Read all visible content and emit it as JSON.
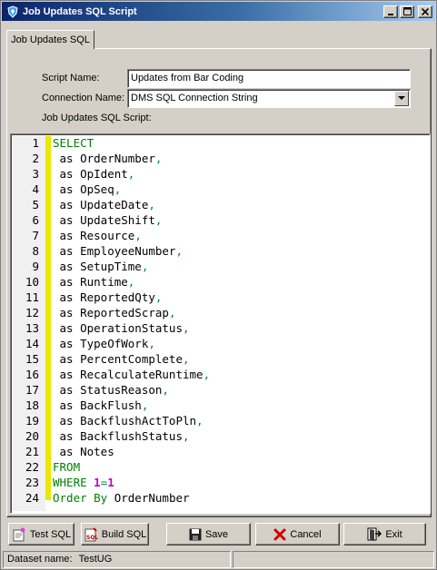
{
  "window": {
    "title": "Job Updates SQL Script"
  },
  "titlebar_buttons": {
    "minimize": "_",
    "maximize": "□",
    "close": "×"
  },
  "tab": {
    "label": "Job Updates SQL"
  },
  "form": {
    "script_name_label": "Script Name:",
    "script_name_value": "Updates from Bar Coding",
    "connection_name_label": "Connection Name:",
    "connection_name_value": "DMS SQL Connection String",
    "script_label": "Job Updates SQL Script:"
  },
  "editor": {
    "lines": [
      {
        "n": "1",
        "tokens": [
          [
            "kw",
            "SELECT"
          ]
        ]
      },
      {
        "n": "2",
        "tokens": [
          [
            "txt",
            " as OrderNumber"
          ],
          [
            "punc",
            ","
          ]
        ]
      },
      {
        "n": "3",
        "tokens": [
          [
            "txt",
            " as OpIdent"
          ],
          [
            "punc",
            ","
          ]
        ]
      },
      {
        "n": "4",
        "tokens": [
          [
            "txt",
            " as OpSeq"
          ],
          [
            "punc",
            ","
          ]
        ]
      },
      {
        "n": "5",
        "tokens": [
          [
            "txt",
            " as UpdateDate"
          ],
          [
            "punc",
            ","
          ]
        ]
      },
      {
        "n": "6",
        "tokens": [
          [
            "txt",
            " as UpdateShift"
          ],
          [
            "punc",
            ","
          ]
        ]
      },
      {
        "n": "7",
        "tokens": [
          [
            "txt",
            " as Resource"
          ],
          [
            "punc",
            ","
          ]
        ]
      },
      {
        "n": "8",
        "tokens": [
          [
            "txt",
            " as EmployeeNumber"
          ],
          [
            "punc",
            ","
          ]
        ]
      },
      {
        "n": "9",
        "tokens": [
          [
            "txt",
            " as SetupTime"
          ],
          [
            "punc",
            ","
          ]
        ]
      },
      {
        "n": "10",
        "tokens": [
          [
            "txt",
            " as Runtime"
          ],
          [
            "punc",
            ","
          ]
        ]
      },
      {
        "n": "11",
        "tokens": [
          [
            "txt",
            " as ReportedQty"
          ],
          [
            "punc",
            ","
          ]
        ]
      },
      {
        "n": "12",
        "tokens": [
          [
            "txt",
            " as ReportedScrap"
          ],
          [
            "punc",
            ","
          ]
        ]
      },
      {
        "n": "13",
        "tokens": [
          [
            "txt",
            " as OperationStatus"
          ],
          [
            "punc",
            ","
          ]
        ]
      },
      {
        "n": "14",
        "tokens": [
          [
            "txt",
            " as TypeOfWork"
          ],
          [
            "punc",
            ","
          ]
        ]
      },
      {
        "n": "15",
        "tokens": [
          [
            "txt",
            " as PercentComplete"
          ],
          [
            "punc",
            ","
          ]
        ]
      },
      {
        "n": "16",
        "tokens": [
          [
            "txt",
            " as RecalculateRuntime"
          ],
          [
            "punc",
            ","
          ]
        ]
      },
      {
        "n": "17",
        "tokens": [
          [
            "txt",
            " as StatusReason"
          ],
          [
            "punc",
            ","
          ]
        ]
      },
      {
        "n": "18",
        "tokens": [
          [
            "txt",
            " as BackFlush"
          ],
          [
            "punc",
            ","
          ]
        ]
      },
      {
        "n": "19",
        "tokens": [
          [
            "txt",
            " as BackflushActToPln"
          ],
          [
            "punc",
            ","
          ]
        ]
      },
      {
        "n": "20",
        "tokens": [
          [
            "txt",
            " as BackflushStatus"
          ],
          [
            "punc",
            ","
          ]
        ]
      },
      {
        "n": "21",
        "tokens": [
          [
            "txt",
            " as Notes"
          ]
        ]
      },
      {
        "n": "22",
        "tokens": [
          [
            "kw",
            "FROM"
          ]
        ]
      },
      {
        "n": "23",
        "tokens": [
          [
            "kw",
            "WHERE "
          ],
          [
            "num",
            "1"
          ],
          [
            "punc",
            "="
          ],
          [
            "num",
            "1"
          ]
        ]
      },
      {
        "n": "24",
        "tokens": [
          [
            "kw",
            "Order By "
          ],
          [
            "txt",
            "OrderNumber"
          ]
        ]
      }
    ]
  },
  "buttons": {
    "test_sql": "Test SQL",
    "build_sql": "Build SQL",
    "save": "Save",
    "cancel": "Cancel",
    "exit": "Exit"
  },
  "status": {
    "dataset_label": "Dataset name:",
    "dataset_value": "TestUG"
  },
  "colors": {
    "title_gradient_start": "#0a246a",
    "keyword": "#008000",
    "number": "#c000c0",
    "change_bar": "#e8e800"
  }
}
